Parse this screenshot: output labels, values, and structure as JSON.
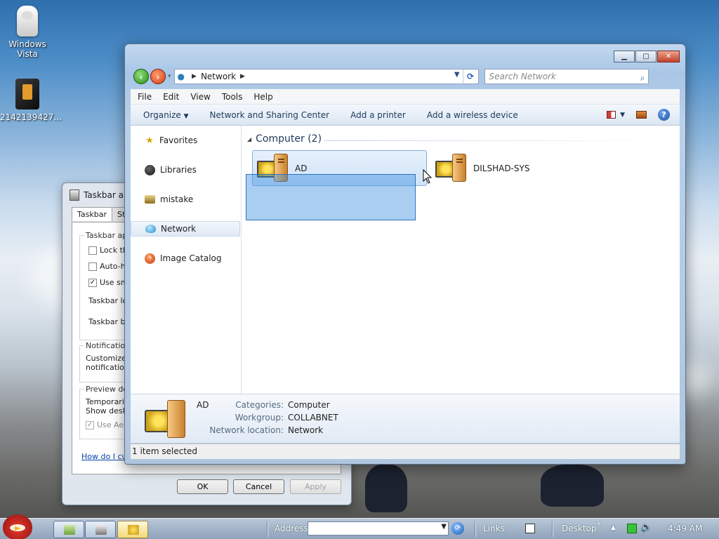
{
  "desktop": {
    "icons": [
      {
        "label": "Windows Vista",
        "icon": "windows-vista-icon"
      },
      {
        "label": "2142139427...",
        "icon": "dark-file-icon"
      }
    ]
  },
  "taskbar_dialog": {
    "title": "Taskbar and",
    "tabs": [
      "Taskbar",
      "Star"
    ],
    "group_appearance": "Taskbar ap",
    "checks": [
      {
        "label": "Lock the",
        "checked": false
      },
      {
        "label": "Auto-hi",
        "checked": false
      },
      {
        "label": "Use sma",
        "checked": true
      }
    ],
    "taskbar_location": "Taskbar loc",
    "taskbar_buttons": "Taskbar bu",
    "group_notification": "Notificatio",
    "notification_text_1": "Customize",
    "notification_text_2": "notification",
    "group_preview": "Preview de",
    "preview_text_1": "Temporaril",
    "preview_text_2": "Show desk",
    "aero_check": "Use Aer",
    "help_link": "How do I cus",
    "buttons": {
      "ok": "OK",
      "cancel": "Cancel",
      "apply": "Apply"
    }
  },
  "explorer": {
    "address": {
      "location": "Network"
    },
    "search_placeholder": "Search Network",
    "menu": [
      "File",
      "Edit",
      "View",
      "Tools",
      "Help"
    ],
    "commands": [
      "Organize",
      "Network and Sharing Center",
      "Add a printer",
      "Add a wireless device"
    ],
    "nav_pane": [
      {
        "label": "Favorites",
        "icon": "star-icon"
      },
      {
        "label": "Libraries",
        "icon": "libraries-icon"
      },
      {
        "label": "mistake",
        "icon": "folder-icon"
      },
      {
        "label": "Network",
        "icon": "network-icon",
        "selected": true
      },
      {
        "label": "Image Catalog",
        "icon": "catalog-icon"
      }
    ],
    "group_header": "Computer (2)",
    "items": [
      {
        "name": "AD",
        "selected": true
      },
      {
        "name": "DILSHAD-SYS",
        "selected": false
      }
    ],
    "details": {
      "name": "AD",
      "labels": [
        "Categories:",
        "Workgroup:",
        "Network location:"
      ],
      "values": [
        "Computer",
        "COLLABNET",
        "Network"
      ]
    },
    "status": "1 item selected"
  },
  "taskbar": {
    "address_label": "Address",
    "links_label": "Links",
    "desktop_label": "Desktop",
    "clock": "4:49 AM"
  }
}
